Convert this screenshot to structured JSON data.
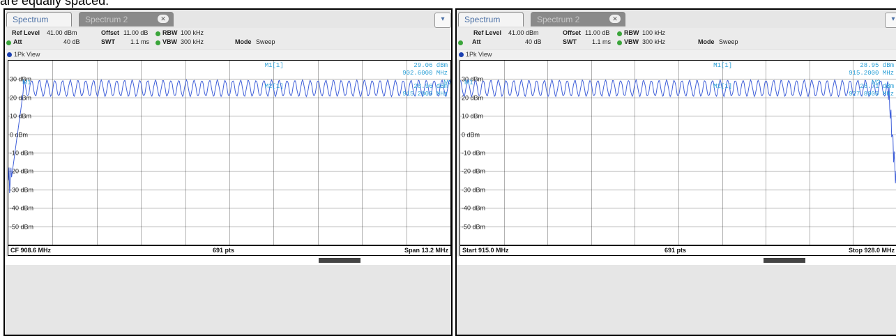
{
  "caption": "are equally spaced.",
  "colors": {
    "trace": "#3f5fd9",
    "marker": "#2a9fd6",
    "grid": "#000000"
  },
  "panels": [
    {
      "tab_active": "Spectrum",
      "tab_inactive": "Spectrum 2",
      "settings": {
        "ref_level_label": "Ref Level",
        "ref_level_value": "41.00 dBm",
        "offset_label": "Offset",
        "offset_value": "11.00 dB",
        "rbw_label": "RBW",
        "rbw_value": "100 kHz",
        "att_label": "Att",
        "att_value": "40 dB",
        "swt_label": "SWT",
        "swt_value": "1.1 ms",
        "vbw_label": "VBW",
        "vbw_value": "300 kHz",
        "mode_label": "Mode",
        "mode_value": "Sweep"
      },
      "view_label": "1Pk View",
      "y_labels": [
        "30 dBm",
        "20 dBm",
        "10 dBm",
        "0 dBm",
        "-10 dBm",
        "-20 dBm",
        "-30 dBm",
        "-40 dBm",
        "-50 dBm"
      ],
      "markers": {
        "m1_label": "M1[1]",
        "m1_level": "29.06 dBm",
        "m1_freq": "902.6000 MHz",
        "m2_label": "M2[1]",
        "m2_level": "28.96 dBm",
        "m2_freq": "915.2000 MHz",
        "m1_tag": "M1",
        "m2_tag": "M2"
      },
      "footer": {
        "left": "CF 908.6 MHz",
        "center": "691 pts",
        "right": "Span 13.2 MHz"
      }
    },
    {
      "tab_active": "Spectrum",
      "tab_inactive": "Spectrum 2",
      "settings": {
        "ref_level_label": "Ref Level",
        "ref_level_value": "41.00 dBm",
        "offset_label": "Offset",
        "offset_value": "11.00 dB",
        "rbw_label": "RBW",
        "rbw_value": "100 kHz",
        "att_label": "Att",
        "att_value": "40 dB",
        "swt_label": "SWT",
        "swt_value": "1.1 ms",
        "vbw_label": "VBW",
        "vbw_value": "300 kHz",
        "mode_label": "Mode",
        "mode_value": "Sweep"
      },
      "view_label": "1Pk View",
      "y_labels": [
        "30 dBm",
        "20 dBm",
        "10 dBm",
        "0 dBm",
        "-10 dBm",
        "-20 dBm",
        "-30 dBm",
        "-40 dBm",
        "-50 dBm"
      ],
      "markers": {
        "m1_label": "M1[1]",
        "m1_level": "28.95 dBm",
        "m1_freq": "915.2000 MHz",
        "m2_label": "M2[1]",
        "m2_level": "28.71 dBm",
        "m2_freq": "927.8000 MHz",
        "m1_tag": "M1",
        "m2_tag": "M2"
      },
      "footer": {
        "left": "Start 915.0 MHz",
        "center": "691 pts",
        "right": "Stop 928.0 MHz"
      }
    }
  ]
}
